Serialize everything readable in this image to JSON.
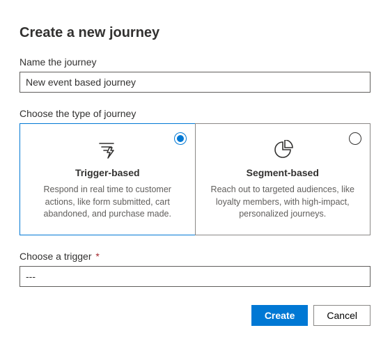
{
  "title": "Create a new journey",
  "name_section": {
    "label": "Name the journey",
    "value": "New event based journey"
  },
  "type_section": {
    "label": "Choose the type of journey",
    "cards": [
      {
        "title": "Trigger-based",
        "desc": "Respond in real time to customer actions, like form submitted, cart abandoned, and purchase made.",
        "selected": true
      },
      {
        "title": "Segment-based",
        "desc": "Reach out to targeted audiences, like loyalty members, with high-impact, personalized journeys.",
        "selected": false
      }
    ]
  },
  "trigger_section": {
    "label": "Choose a trigger",
    "required_mark": "*",
    "value": "---"
  },
  "footer": {
    "create": "Create",
    "cancel": "Cancel"
  }
}
